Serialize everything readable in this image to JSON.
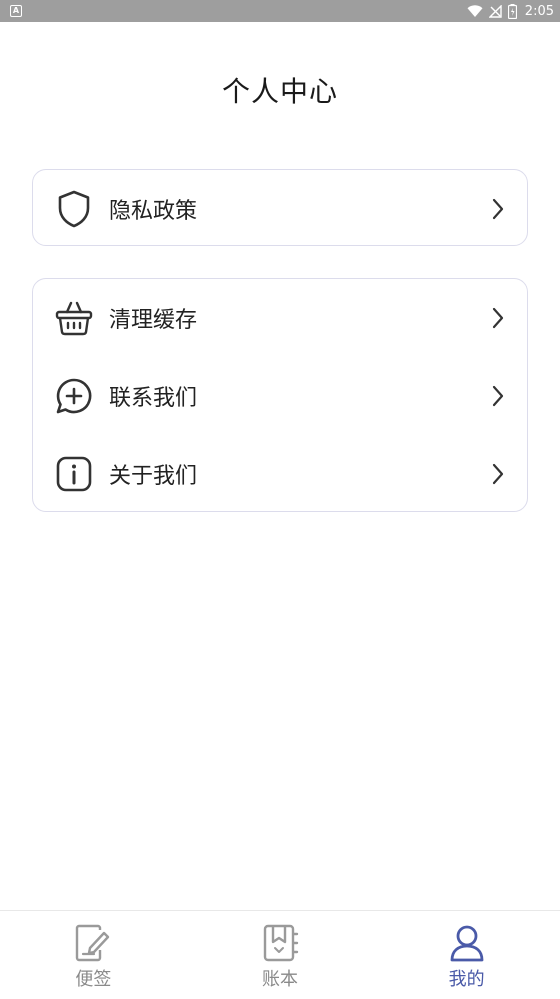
{
  "status_bar": {
    "app_indicator": "A",
    "time": "2:05",
    "icons": [
      "wifi-icon",
      "no-signal-icon",
      "battery-icon"
    ]
  },
  "header": {
    "title": "个人中心"
  },
  "menu": {
    "group1": [
      {
        "label": "隐私政策",
        "icon": "shield-icon"
      }
    ],
    "group2": [
      {
        "label": "清理缓存",
        "icon": "basket-icon"
      },
      {
        "label": "联系我们",
        "icon": "chat-plus-icon"
      },
      {
        "label": "关于我们",
        "icon": "info-icon"
      }
    ]
  },
  "bottom_nav": {
    "items": [
      {
        "label": "便签",
        "icon": "note-edit-icon",
        "active": false
      },
      {
        "label": "账本",
        "icon": "ledger-icon",
        "active": false
      },
      {
        "label": "我的",
        "icon": "user-icon",
        "active": true
      }
    ]
  },
  "colors": {
    "accent": "#4a5aa8",
    "inactive": "#8a8a8a",
    "card_border": "#dcdcec",
    "status_bar": "#9e9e9e"
  }
}
